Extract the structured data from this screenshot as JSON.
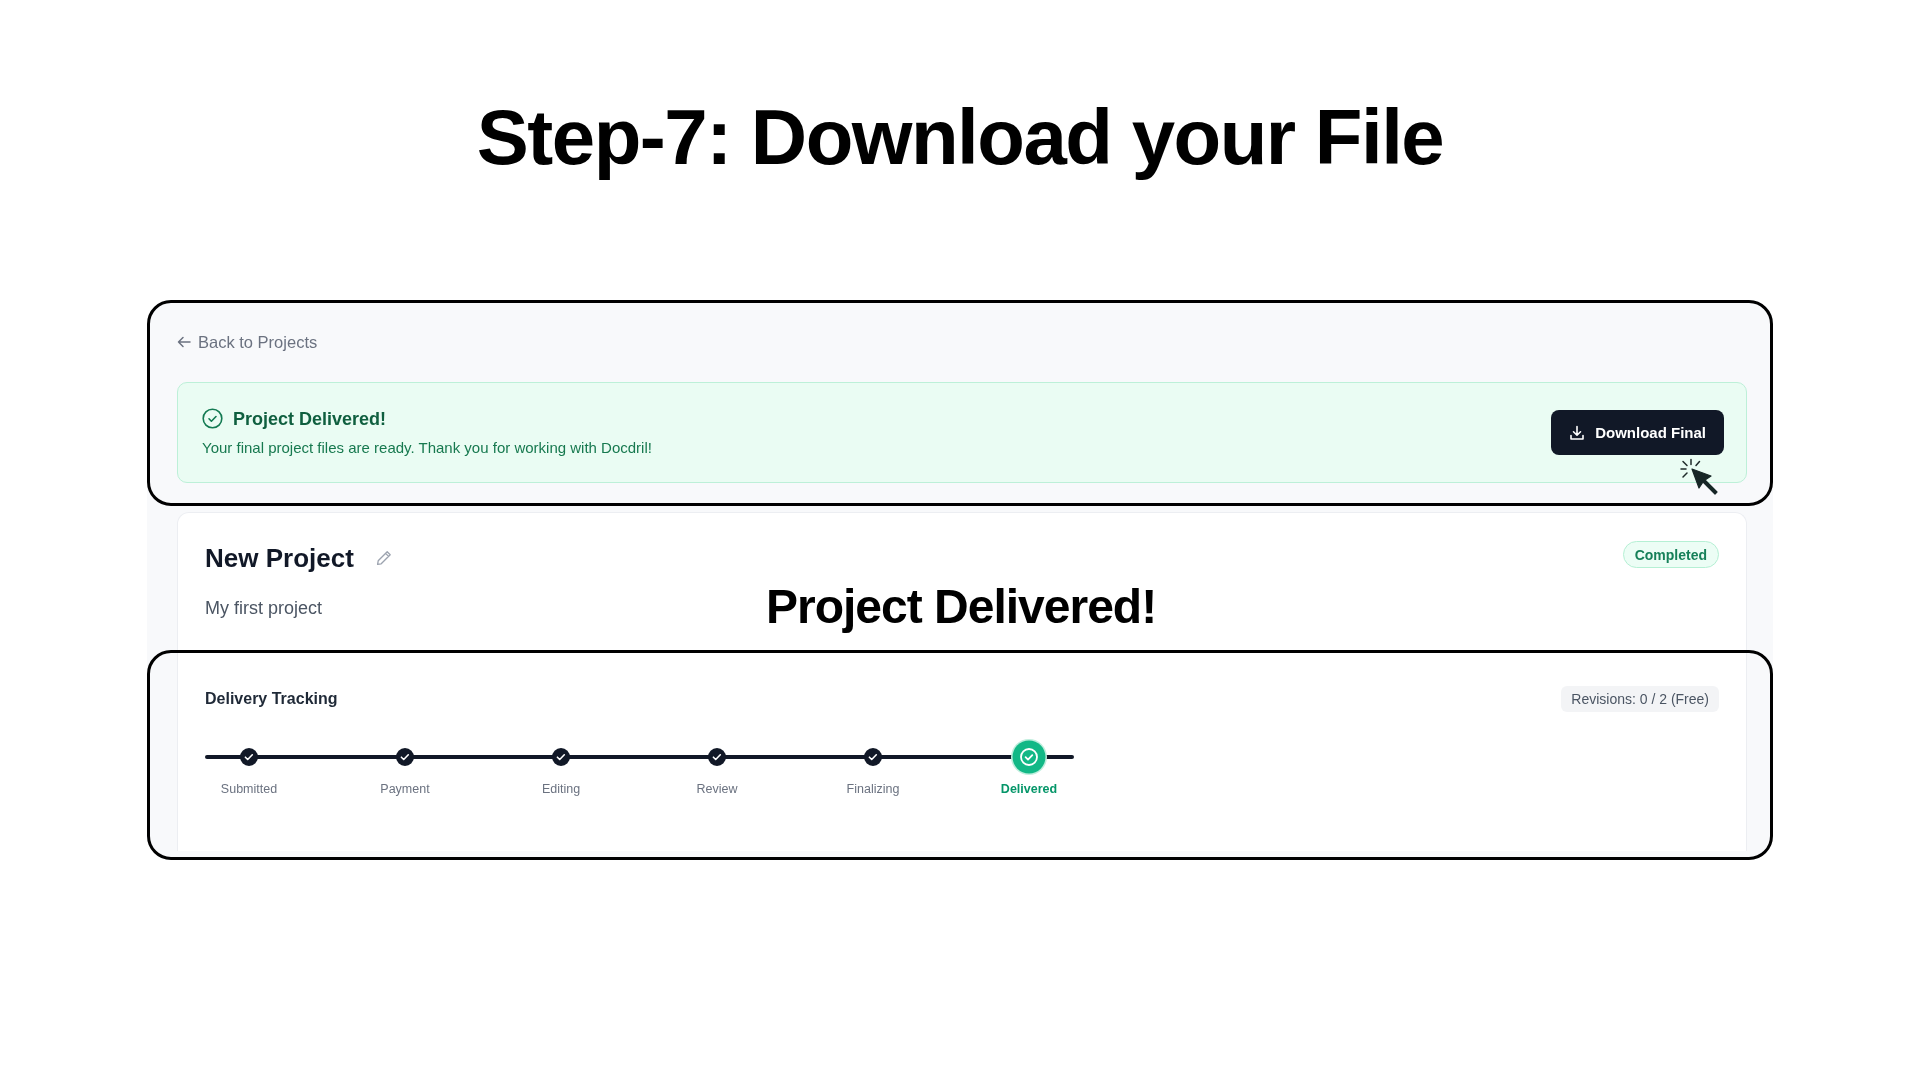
{
  "slide_title": "Step-7: Download your File",
  "back_link": "Back to Projects",
  "banner": {
    "title": "Project Delivered!",
    "message": "Your final project files are ready. Thank you for working with Docdril!",
    "button": "Download Final"
  },
  "project": {
    "name": "New Project",
    "status": "Completed",
    "description": "My first project"
  },
  "annotation": "Project Delivered!",
  "tracking": {
    "title": "Delivery Tracking",
    "revisions": "Revisions: 0 / 2 (Free)",
    "steps": [
      {
        "label": "Submitted",
        "complete": true,
        "current": false
      },
      {
        "label": "Payment",
        "complete": true,
        "current": false
      },
      {
        "label": "Editing",
        "complete": true,
        "current": false
      },
      {
        "label": "Review",
        "complete": true,
        "current": false
      },
      {
        "label": "Finalizing",
        "complete": true,
        "current": false
      },
      {
        "label": "Delivered",
        "complete": true,
        "current": true
      }
    ]
  }
}
